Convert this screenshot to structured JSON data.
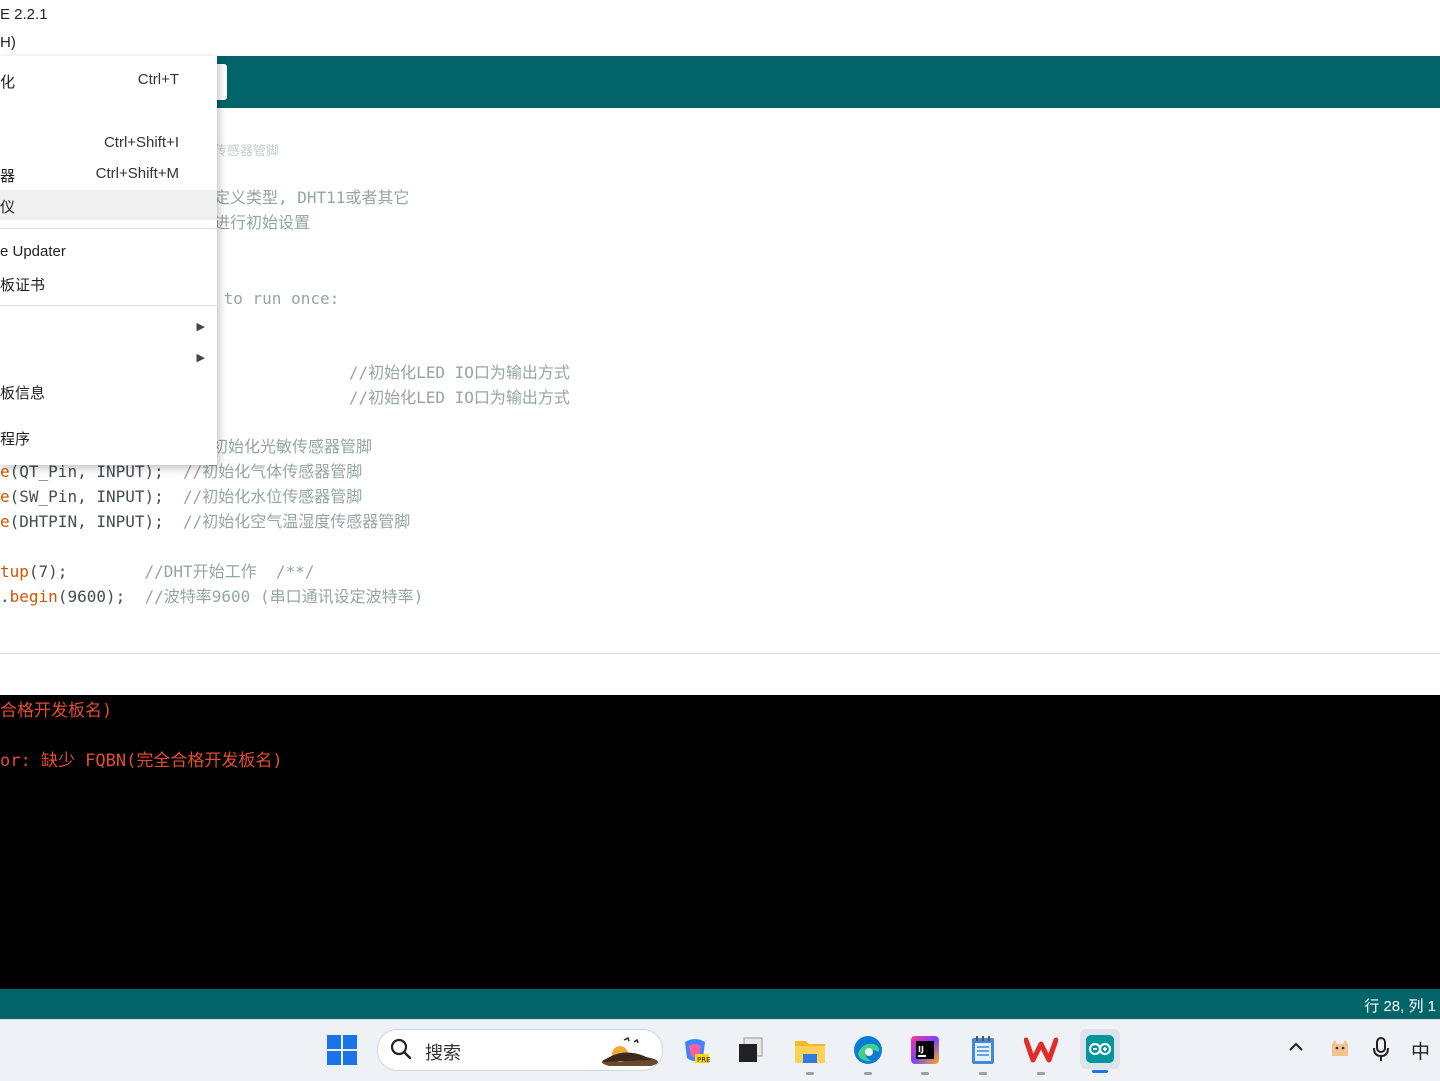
{
  "window": {
    "title": "E 2.2.1",
    "menu_fragment": "H)"
  },
  "dropdown": {
    "items": [
      {
        "label": "化",
        "shortcut": "Ctrl+T"
      },
      {
        "label": "",
        "shortcut": "Ctrl+Shift+I"
      },
      {
        "label": "器",
        "shortcut": "Ctrl+Shift+M"
      },
      {
        "label": "仪",
        "shortcut": ""
      },
      {
        "label": "e Updater",
        "shortcut": ""
      },
      {
        "label": "板证书",
        "shortcut": ""
      },
      {
        "label": "",
        "shortcut": ""
      },
      {
        "label": "",
        "shortcut": ""
      },
      {
        "label": "板信息",
        "shortcut": ""
      },
      {
        "label": "程序",
        "shortcut": ""
      }
    ]
  },
  "editor": {
    "lines": [
      [
        {
          "t": "传感器管脚",
          "k": "c"
        }
      ],
      [
        {
          "t": "定义类型, DHT11或者其它",
          "k": "c"
        }
      ],
      [
        {
          "t": "进行初始设置",
          "k": "c"
        }
      ],
      [
        {
          "t": " to run once:",
          "k": "c"
        }
      ],
      [
        {
          "t": "              //初始化LED IO口为输出方式",
          "k": "c"
        }
      ],
      [
        {
          "t": "              //初始化LED IO口为输出方式",
          "k": "c"
        }
      ],
      [
        {
          "t": "初始化光敏传感器管脚",
          "k": "c"
        }
      ],
      [
        {
          "t": "e",
          "k": "f"
        },
        {
          "t": "(QT_Pin, INPUT);  ",
          "k": "n"
        },
        {
          "t": "//初始化气体传感器管脚",
          "k": "c"
        }
      ],
      [
        {
          "t": "e",
          "k": "f"
        },
        {
          "t": "(SW_Pin, INPUT);  ",
          "k": "n"
        },
        {
          "t": "//初始化水位传感器管脚",
          "k": "c"
        }
      ],
      [
        {
          "t": "e",
          "k": "f"
        },
        {
          "t": "(DHTPIN, INPUT);  ",
          "k": "n"
        },
        {
          "t": "//初始化空气温湿度传感器管脚",
          "k": "c"
        }
      ],
      [
        {
          "t": "tup",
          "k": "f"
        },
        {
          "t": "(7);        ",
          "k": "n"
        },
        {
          "t": "//DHT开始工作  /**/",
          "k": "c"
        }
      ],
      [
        {
          "t": ".",
          "k": "n"
        },
        {
          "t": "begin",
          "k": "f"
        },
        {
          "t": "(9600);  ",
          "k": "n"
        },
        {
          "t": "//波特率9600 (串口通讯设定波特率)",
          "k": "c"
        }
      ]
    ]
  },
  "console": {
    "lines": [
      "合格开发板名)",
      "",
      "or: 缺少 FQBN(完全合格开发板名)"
    ]
  },
  "statusbar": {
    "position": "行 28, 列 1"
  },
  "taskbar": {
    "search_placeholder": "搜索",
    "ime_indicator": "中"
  },
  "colors": {
    "toolbar": "#006468",
    "console_bg": "#000000",
    "error_text": "#e34c33",
    "comment": "#95a5a6",
    "function": "#d35400"
  }
}
